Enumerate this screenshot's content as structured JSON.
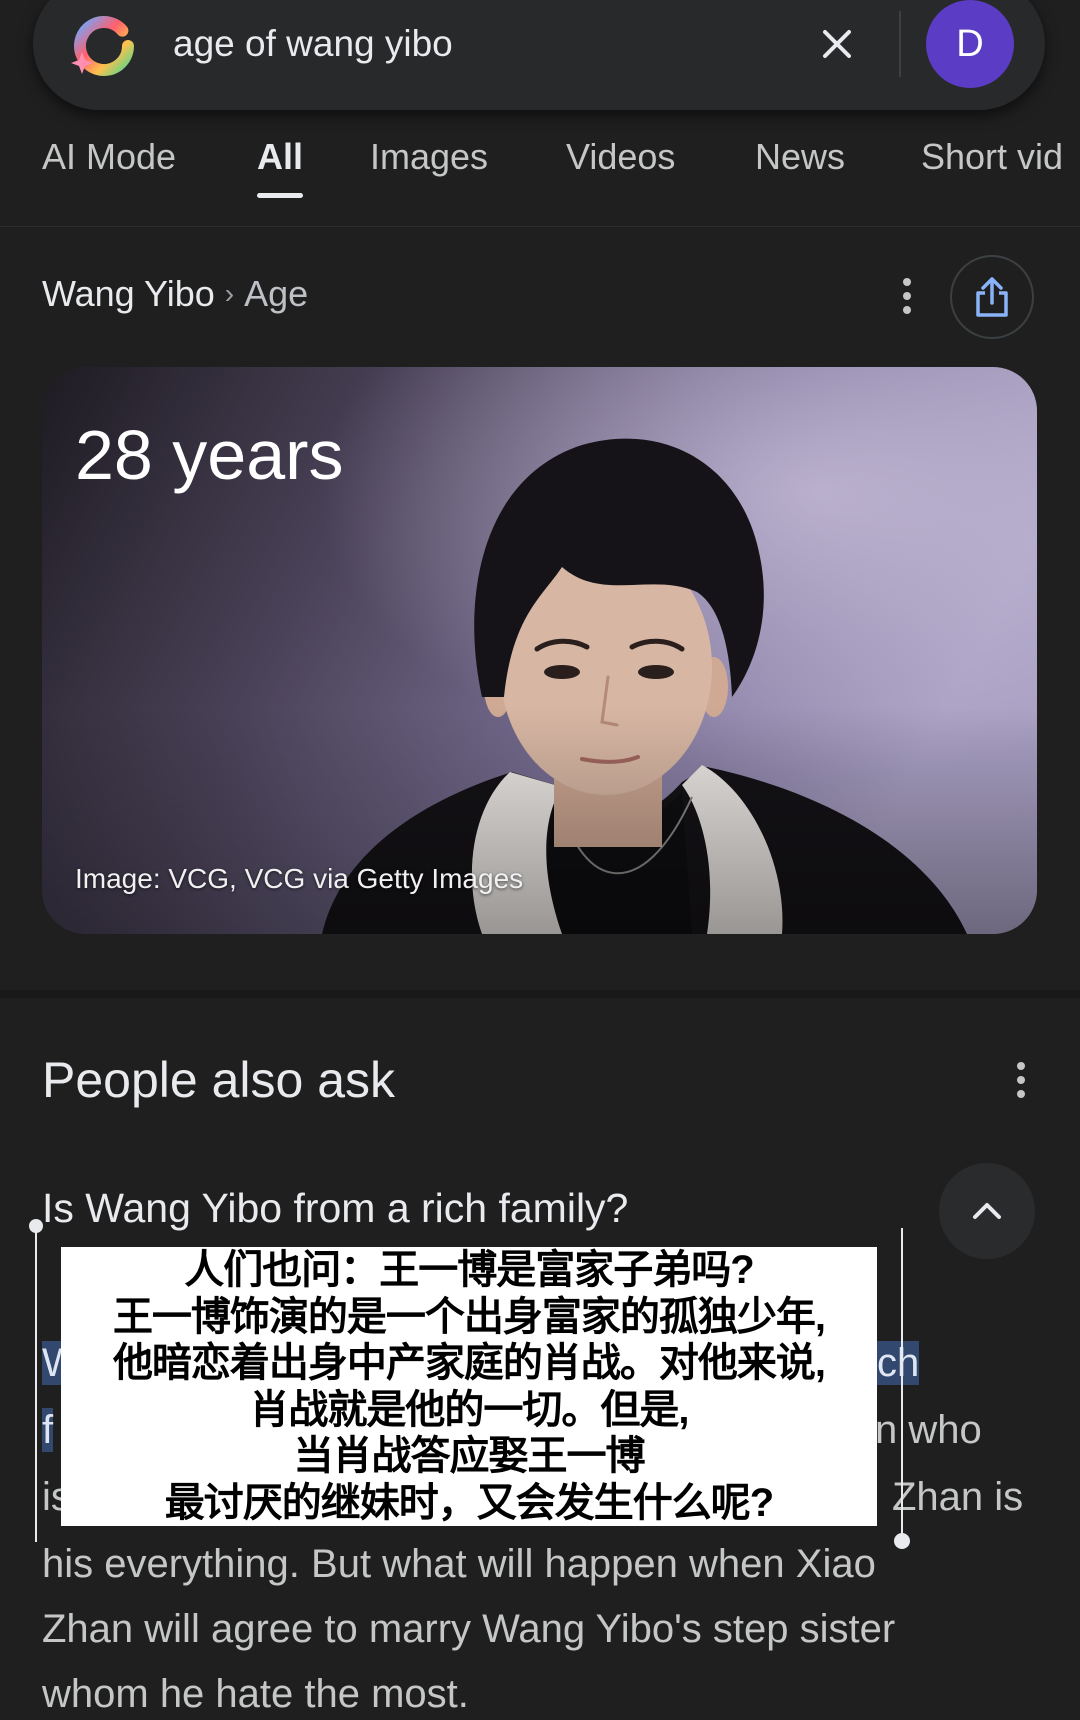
{
  "search": {
    "query": "age of wang yibo",
    "logo_icon": "google-g-icon",
    "clear_icon": "close-icon",
    "avatar_letter": "D"
  },
  "tabs": [
    {
      "label": "AI Mode",
      "active": false
    },
    {
      "label": "All",
      "active": true
    },
    {
      "label": "Images",
      "active": false
    },
    {
      "label": "Videos",
      "active": false
    },
    {
      "label": "News",
      "active": false
    },
    {
      "label": "Short vid",
      "active": false
    }
  ],
  "breadcrumb": {
    "entity": "Wang Yibo",
    "separator": "›",
    "attribute": "Age",
    "more_icon": "more-vert-icon",
    "share_icon": "share-icon"
  },
  "answer_card": {
    "value": "28 years",
    "image_credit": "Image: VCG, VCG via Getty Images"
  },
  "people_also_ask": {
    "heading": "People also ask",
    "more_icon": "more-vert-icon",
    "question": "Is Wang Yibo from a rich family?",
    "collapse_icon": "chevron-up-icon",
    "answer_lines": [
      {
        "left": "W",
        "right": "ch"
      },
      {
        "left": "f",
        "right": "n who"
      },
      {
        "left": "is",
        "right": "Zhan is"
      },
      {
        "text": "his everything. But what will happen when Xiao"
      },
      {
        "text": "Zhan will agree to marry Wang Yibo's step sister"
      },
      {
        "text": "whom he hate the most."
      }
    ]
  },
  "overlay": {
    "lines": [
      "人们也问：王一博是富家子弟吗?",
      "王一博饰演的是一个出身富家的孤独少年,",
      "他暗恋着出身中产家庭的肖战。对他来说,",
      "肖战就是他的一切。但是,",
      "当肖战答应娶王一博",
      "最讨厌的继妹时，又会发生什么呢?"
    ]
  },
  "colors": {
    "background": "#1f1f1f",
    "search_pill": "#28292b",
    "avatar": "#5b3cc4",
    "share_icon": "#8ab4f8",
    "selection_highlight": "#33486e",
    "text_primary": "#e8eaed",
    "text_secondary": "#c4c7c5"
  }
}
